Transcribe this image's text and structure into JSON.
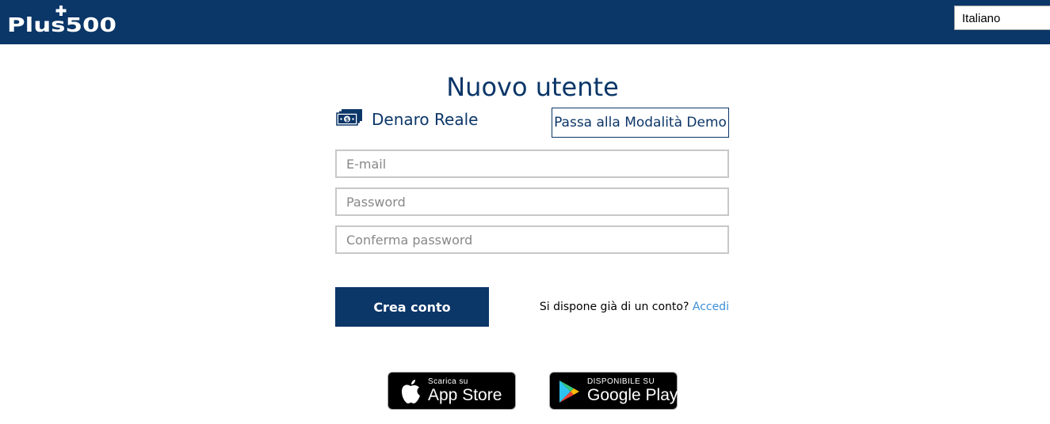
{
  "brand": {
    "logo_text": "Plus500"
  },
  "language_select": {
    "selected": "Italiano"
  },
  "page": {
    "title": "Nuovo utente"
  },
  "account_mode": {
    "current_label": "Denaro Reale",
    "switch_button_label": "Passa alla Modalità Demo",
    "icon": "money-icon"
  },
  "form": {
    "email_placeholder": "E-mail",
    "password_placeholder": "Password",
    "confirm_password_placeholder": "Conferma password",
    "submit_label": "Crea conto"
  },
  "login_prompt": {
    "text": "Si dispone già di un conto?",
    "link_label": "Accedi"
  },
  "stores": {
    "apple": {
      "small_text": "Scarica su",
      "big_text": "App Store",
      "icon": "apple-icon"
    },
    "google": {
      "small_text": "DISPONIBILE SU",
      "big_text": "Google Play",
      "icon": "google-play-icon"
    }
  },
  "colors": {
    "brand_navy": "#0b3668",
    "link_blue": "#3d8fd6",
    "field_border": "#c8c8c8"
  }
}
